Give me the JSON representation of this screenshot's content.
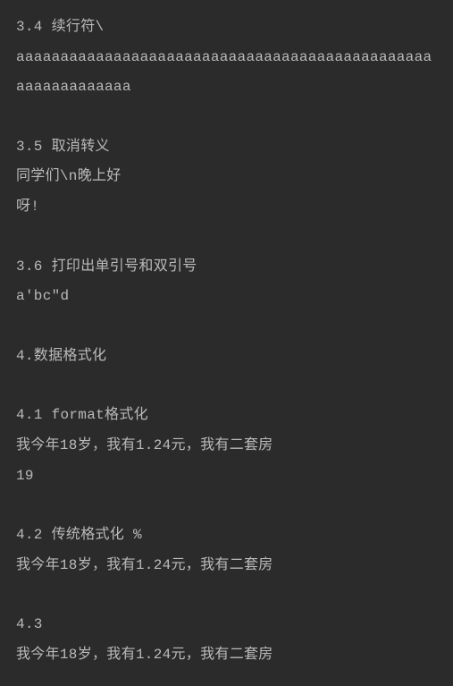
{
  "lines": [
    "3.4 续行符\\",
    "aaaaaaaaaaaaaaaaaaaaaaaaaaaaaaaaaaaaaaaaaaaaaaaaaaaaaaaaaaaa",
    "",
    "3.5 取消转义",
    "同学们\\n晚上好",
    "呀!",
    "",
    "3.6 打印出单引号和双引号",
    "a'bc\"d",
    "",
    "4.数据格式化",
    "",
    "4.1 format格式化",
    "我今年18岁，我有1.24元，我有二套房",
    "19",
    "",
    "4.2 传统格式化 %",
    "我今年18岁，我有1.24元，我有二套房",
    "",
    "4.3",
    "我今年18岁，我有1.24元，我有二套房"
  ]
}
